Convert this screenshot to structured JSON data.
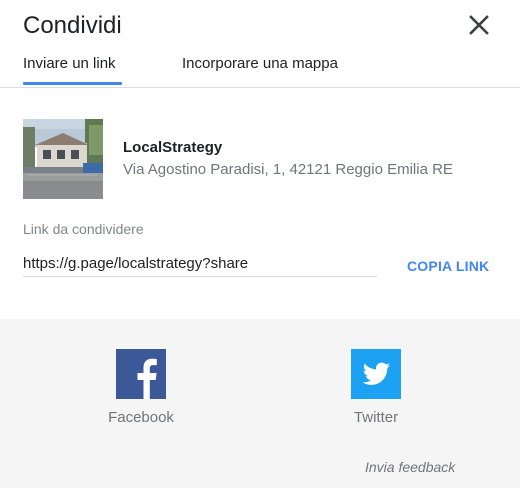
{
  "dialog": {
    "title": "Condividi",
    "close_icon": "close-icon"
  },
  "tabs": [
    {
      "label": "Inviare un link",
      "active": true
    },
    {
      "label": "Incorporare una mappa",
      "active": false
    }
  ],
  "place": {
    "name": "LocalStrategy",
    "address": "Via Agostino Paradisi, 1, 42121 Reggio Emilia RE"
  },
  "link": {
    "label": "Link da condividere",
    "value": "https://g.page/localstrategy?share",
    "copy_label": "COPIA LINK"
  },
  "social": {
    "facebook": {
      "label": "Facebook",
      "icon": "facebook-icon",
      "color": "#3b5998"
    },
    "twitter": {
      "label": "Twitter",
      "icon": "twitter-icon",
      "color": "#1da1f2"
    }
  },
  "footer": {
    "feedback_label": "Invia feedback"
  },
  "colors": {
    "accent": "#4285f4",
    "share_background": "#f5f5f5"
  }
}
